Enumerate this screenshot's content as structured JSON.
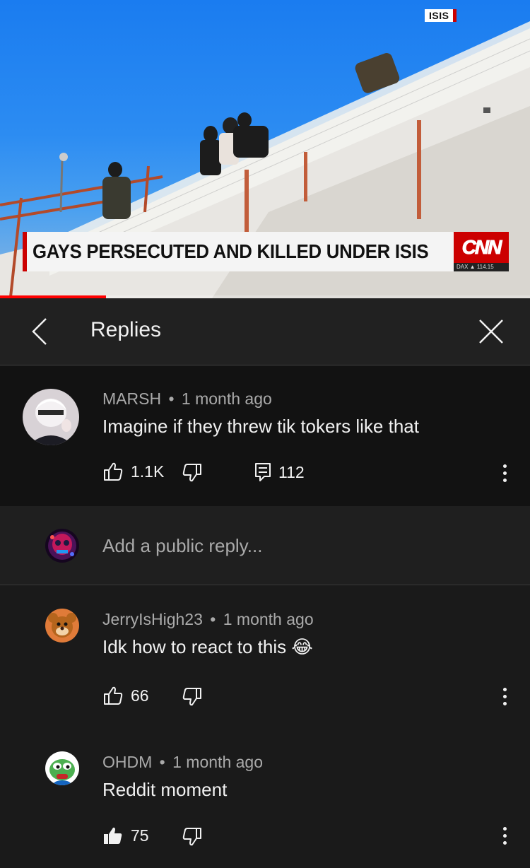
{
  "video": {
    "corner_tag": "ISIS",
    "chyron": "GAYS PERSECUTED AND KILLED UNDER ISIS",
    "network_logo": "CNN",
    "ticker": "DAX ▲ 114.15",
    "progress_fraction": 0.2,
    "accent_color": "#cc0000"
  },
  "panel": {
    "title": "Replies",
    "back_icon": "chevron-left-icon",
    "close_icon": "close-icon"
  },
  "parent_comment": {
    "author": "MARSH",
    "separator": "•",
    "time": "1 month ago",
    "text": "Imagine if they threw tik tokers like that",
    "likes": "1.1K",
    "replies": "112"
  },
  "add_reply": {
    "placeholder": "Add a public reply..."
  },
  "replies": [
    {
      "author": "JerryIsHigh23",
      "separator": "•",
      "time": "1 month ago",
      "text": "Idk how to react to this",
      "emoji": "😂",
      "likes": "66",
      "liked": false
    },
    {
      "author": "OHDM",
      "separator": "•",
      "time": "1 month ago",
      "text": "Reddit moment",
      "likes": "75",
      "liked": true
    }
  ]
}
